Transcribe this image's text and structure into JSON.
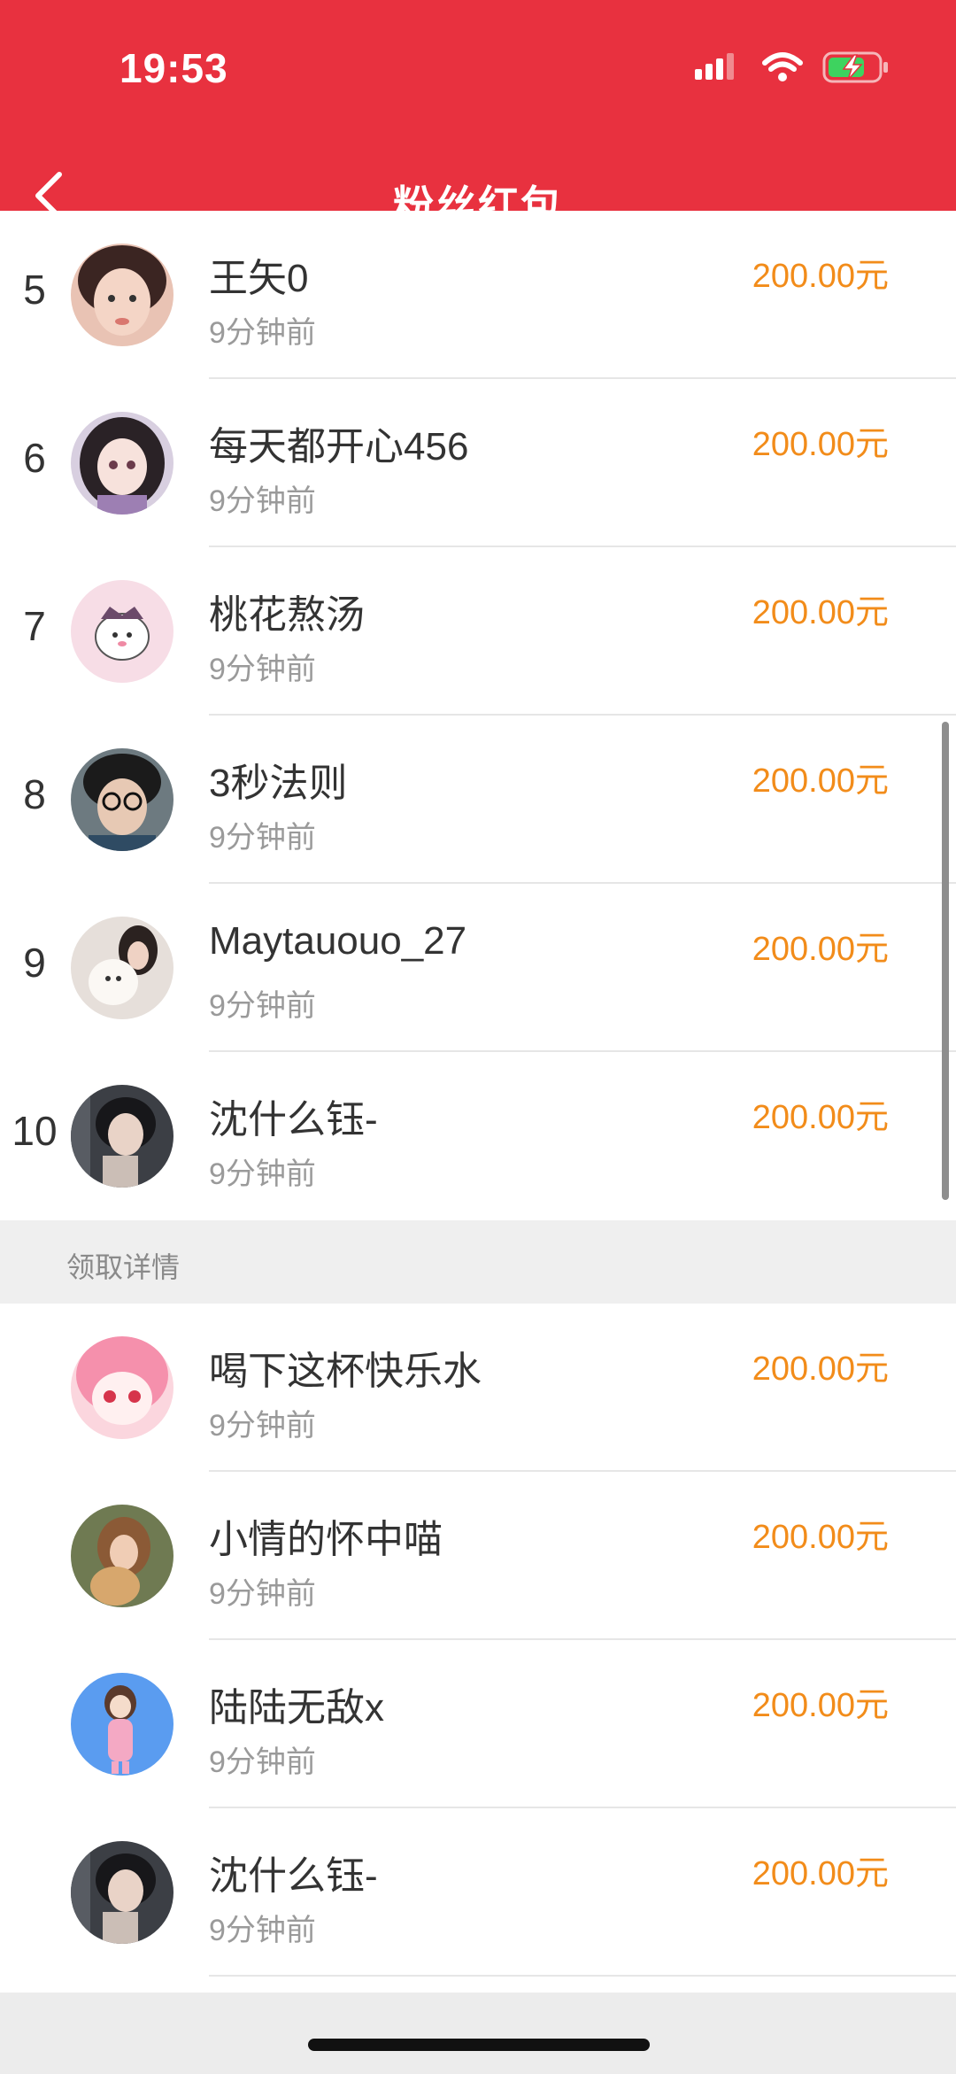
{
  "status_bar": {
    "time": "19:53"
  },
  "nav": {
    "title": "粉丝红包"
  },
  "colors": {
    "header_red": "#e8313f",
    "amount_orange": "#f28c1a",
    "section_bg": "#efefef"
  },
  "rank_list": [
    {
      "rank": "5",
      "name": "王矢0",
      "time": "9分钟前",
      "amount": "200.00元",
      "avatar": "avatar-girl-selfie"
    },
    {
      "rank": "6",
      "name": "每天都开心456",
      "time": "9分钟前",
      "amount": "200.00元",
      "avatar": "avatar-anime-girl"
    },
    {
      "rank": "7",
      "name": "桃花熬汤",
      "time": "9分钟前",
      "amount": "200.00元",
      "avatar": "avatar-cartoon-pink"
    },
    {
      "rank": "8",
      "name": "3秒法则",
      "time": "9分钟前",
      "amount": "200.00元",
      "avatar": "avatar-boy-glasses"
    },
    {
      "rank": "9",
      "name": "Maytauouo_27",
      "time": "9分钟前",
      "amount": "200.00元",
      "avatar": "avatar-girl-dog"
    },
    {
      "rank": "10",
      "name": "沈什么钰-",
      "time": "9分钟前",
      "amount": "200.00元",
      "avatar": "avatar-girl-car"
    }
  ],
  "section": {
    "title": "领取详情"
  },
  "detail_list": [
    {
      "name": "喝下这杯快乐水",
      "time": "9分钟前",
      "amount": "200.00元",
      "avatar": "avatar-anime-pink-hair"
    },
    {
      "name": "小情的怀中喵",
      "time": "9分钟前",
      "amount": "200.00元",
      "avatar": "avatar-girl-cat"
    },
    {
      "name": "陆陆无敌x",
      "time": "9分钟前",
      "amount": "200.00元",
      "avatar": "avatar-cartoon-blue"
    },
    {
      "name": "沈什么钰-",
      "time": "9分钟前",
      "amount": "200.00元",
      "avatar": "avatar-girl-car"
    }
  ]
}
